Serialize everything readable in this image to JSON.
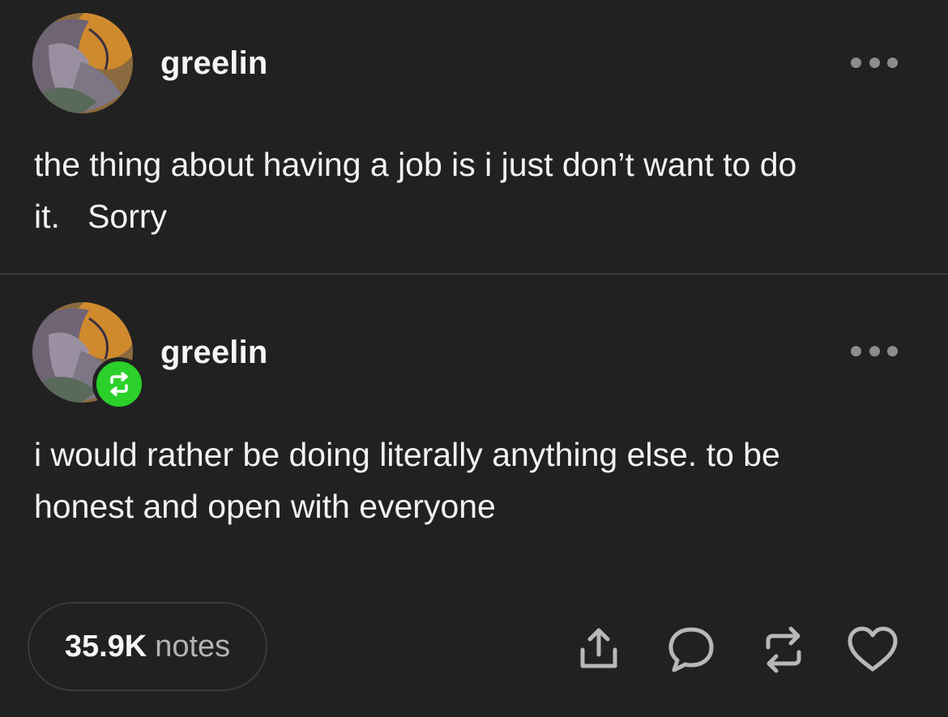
{
  "posts": [
    {
      "username": "greelin",
      "text": "the thing about having a job is i just don’t want to do\nit.   Sorry",
      "is_reblog": false
    },
    {
      "username": "greelin",
      "text": "i would rather be doing literally anything else. to be\nhonest and open with everyone",
      "is_reblog": true
    }
  ],
  "footer": {
    "notes_count": "35.9K",
    "notes_label": "notes",
    "actions": [
      "share-icon",
      "reply-icon",
      "reblog-icon",
      "heart-icon"
    ]
  },
  "colors": {
    "background": "#212121",
    "text": "#f2f2f2",
    "reblog_badge": "#2bd02b",
    "icon": "#b8b8b8"
  }
}
